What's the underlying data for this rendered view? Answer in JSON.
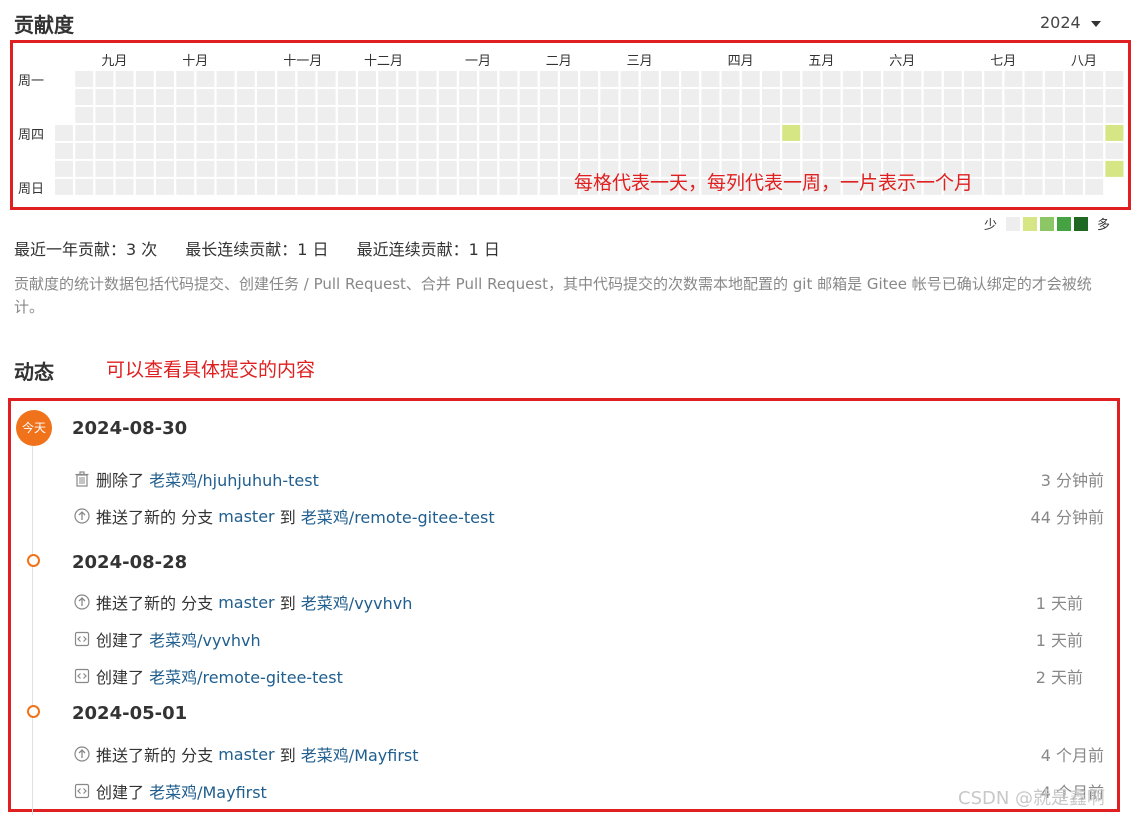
{
  "contrib": {
    "title": "贡献度",
    "year": "2024",
    "months": [
      "九月",
      "十月",
      "十一月",
      "十二月",
      "一月",
      "二月",
      "三月",
      "四月",
      "五月",
      "六月",
      "七月",
      "八月"
    ],
    "days": [
      "周一",
      "周四",
      "周日"
    ],
    "annotation": "每格代表一天，每列代表一周，一片表示一个月",
    "legend": {
      "less": "少",
      "more": "多",
      "colors": [
        "#eeeeee",
        "#d6e685",
        "#8cc665",
        "#44a340",
        "#1e6823"
      ]
    },
    "empty_color": "#eeeeee",
    "active_color": "#d6e685"
  },
  "stats": {
    "year_total": "最近一年贡献：3 次",
    "longest_streak": "最长连续贡献：1 日",
    "current_streak": "最近连续贡献：1 日"
  },
  "note": "贡献度的统计数据包括代码提交、创建任务 / Pull Request、合并 Pull Request，其中代码提交的次数需本地配置的 git 邮箱是 Gitee 帐号已确认绑定的才会被统计。",
  "dynamics": {
    "title": "动态",
    "annotation": "可以查看具体提交的内容",
    "today_badge": "今天",
    "groups": [
      {
        "date": "2024-08-30",
        "events": [
          {
            "icon": "trash-icon",
            "action": "删除了",
            "repo": "老菜鸡/hjuhjuhuh-test",
            "time": "3 分钟前"
          },
          {
            "icon": "push-icon",
            "action": "推送了新的 分支",
            "branch": "master",
            "to": "到",
            "repo": "老菜鸡/remote-gitee-test",
            "time": "44 分钟前"
          }
        ]
      },
      {
        "date": "2024-08-28",
        "events": [
          {
            "icon": "push-icon",
            "action": "推送了新的 分支",
            "branch": "master",
            "to": "到",
            "repo": "老菜鸡/vyvhvh",
            "time": "1 天前"
          },
          {
            "icon": "code-repo-icon",
            "action": "创建了",
            "repo": "老菜鸡/vyvhvh",
            "time": "1 天前"
          },
          {
            "icon": "code-repo-icon",
            "action": "创建了",
            "repo": "老菜鸡/remote-gitee-test",
            "time": "2 天前"
          }
        ]
      },
      {
        "date": "2024-05-01",
        "events": [
          {
            "icon": "push-icon",
            "action": "推送了新的 分支",
            "branch": "master",
            "to": "到",
            "repo": "老菜鸡/Mayfirst",
            "time": "4 个月前"
          },
          {
            "icon": "code-repo-icon",
            "action": "创建了",
            "repo": "老菜鸡/Mayfirst",
            "time": "4 个月前"
          }
        ]
      }
    ]
  },
  "watermark": "CSDN @就是鑫啊"
}
